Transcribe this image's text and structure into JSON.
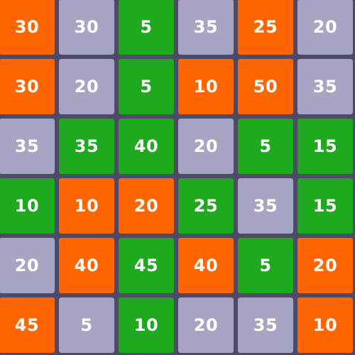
{
  "colors": {
    "background": "#4e4a66",
    "orange": "#ff6600",
    "gray": "#a6a5c3",
    "green": "#1ea91e",
    "text": "#ffffff"
  },
  "grid": {
    "rows": [
      [
        {
          "value": "30",
          "color": "orange"
        },
        {
          "value": "30",
          "color": "gray"
        },
        {
          "value": "5",
          "color": "green"
        },
        {
          "value": "35",
          "color": "gray"
        },
        {
          "value": "25",
          "color": "orange"
        },
        {
          "value": "20",
          "color": "gray"
        }
      ],
      [
        {
          "value": "30",
          "color": "orange"
        },
        {
          "value": "20",
          "color": "gray"
        },
        {
          "value": "5",
          "color": "green"
        },
        {
          "value": "10",
          "color": "orange"
        },
        {
          "value": "50",
          "color": "orange"
        },
        {
          "value": "35",
          "color": "gray"
        }
      ],
      [
        {
          "value": "35",
          "color": "gray"
        },
        {
          "value": "35",
          "color": "green"
        },
        {
          "value": "40",
          "color": "green"
        },
        {
          "value": "20",
          "color": "gray"
        },
        {
          "value": "5",
          "color": "green"
        },
        {
          "value": "15",
          "color": "green"
        }
      ],
      [
        {
          "value": "10",
          "color": "green"
        },
        {
          "value": "10",
          "color": "orange"
        },
        {
          "value": "20",
          "color": "orange"
        },
        {
          "value": "25",
          "color": "green"
        },
        {
          "value": "35",
          "color": "gray"
        },
        {
          "value": "15",
          "color": "green"
        }
      ],
      [
        {
          "value": "20",
          "color": "gray"
        },
        {
          "value": "40",
          "color": "orange"
        },
        {
          "value": "45",
          "color": "green"
        },
        {
          "value": "40",
          "color": "orange"
        },
        {
          "value": "5",
          "color": "green"
        },
        {
          "value": "20",
          "color": "orange"
        }
      ],
      [
        {
          "value": "45",
          "color": "orange"
        },
        {
          "value": "5",
          "color": "gray"
        },
        {
          "value": "10",
          "color": "green"
        },
        {
          "value": "20",
          "color": "gray"
        },
        {
          "value": "35",
          "color": "gray"
        },
        {
          "value": "10",
          "color": "orange"
        }
      ]
    ]
  }
}
